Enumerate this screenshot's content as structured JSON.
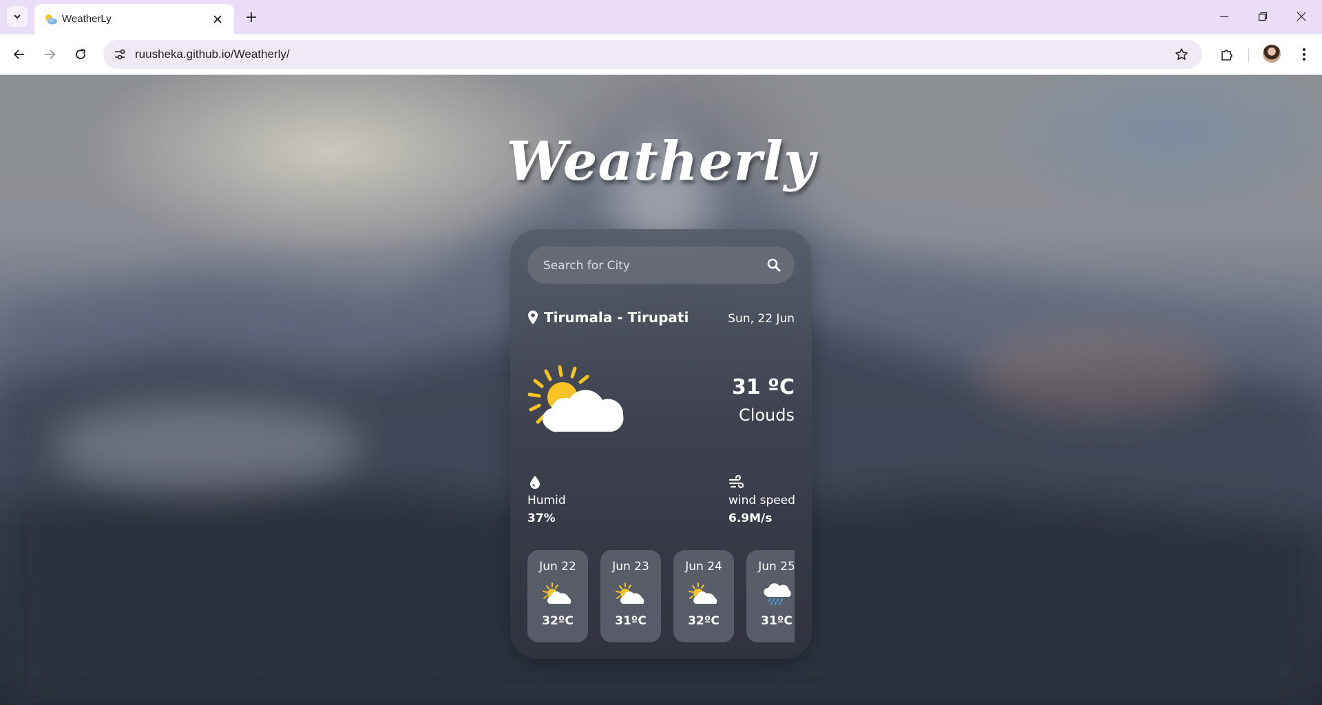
{
  "browser": {
    "tab_title": "WeatherLy",
    "url": "ruusheka.github.io/Weatherly/",
    "icons": {
      "tab_list": "chevron-down-icon",
      "close_tab": "close-icon",
      "new_tab": "plus-icon",
      "back": "arrow-left-icon",
      "forward": "arrow-right-icon",
      "reload": "reload-icon",
      "site_info": "tune-icon",
      "bookmark": "star-icon",
      "extensions": "puzzle-icon",
      "menu": "kebab-menu-icon"
    }
  },
  "app": {
    "title": "Weatherly",
    "search": {
      "placeholder": "Search for City",
      "value": ""
    },
    "location": "Tirumala - Tirupati",
    "date": "Sun, 22 Jun",
    "current": {
      "temperature": "31 ºC",
      "condition": "Clouds",
      "icon": "partly-cloudy-icon"
    },
    "stats": {
      "humidity": {
        "label": "Humid",
        "value": "37%",
        "icon": "water-drop-icon"
      },
      "wind": {
        "label": "wind speed",
        "value": "6.9M/s",
        "icon": "wind-icon"
      }
    },
    "forecast": [
      {
        "date": "Jun 22",
        "temp": "32ºC",
        "icon": "partly-cloudy-icon"
      },
      {
        "date": "Jun 23",
        "temp": "31ºC",
        "icon": "partly-cloudy-icon"
      },
      {
        "date": "Jun 24",
        "temp": "32ºC",
        "icon": "partly-cloudy-icon"
      },
      {
        "date": "Jun 25",
        "temp": "31ºC",
        "icon": "rain-cloud-icon"
      }
    ]
  },
  "colors": {
    "sun": "#f7c325",
    "cloud": "#ffffff",
    "rain": "#4aa3e0"
  }
}
